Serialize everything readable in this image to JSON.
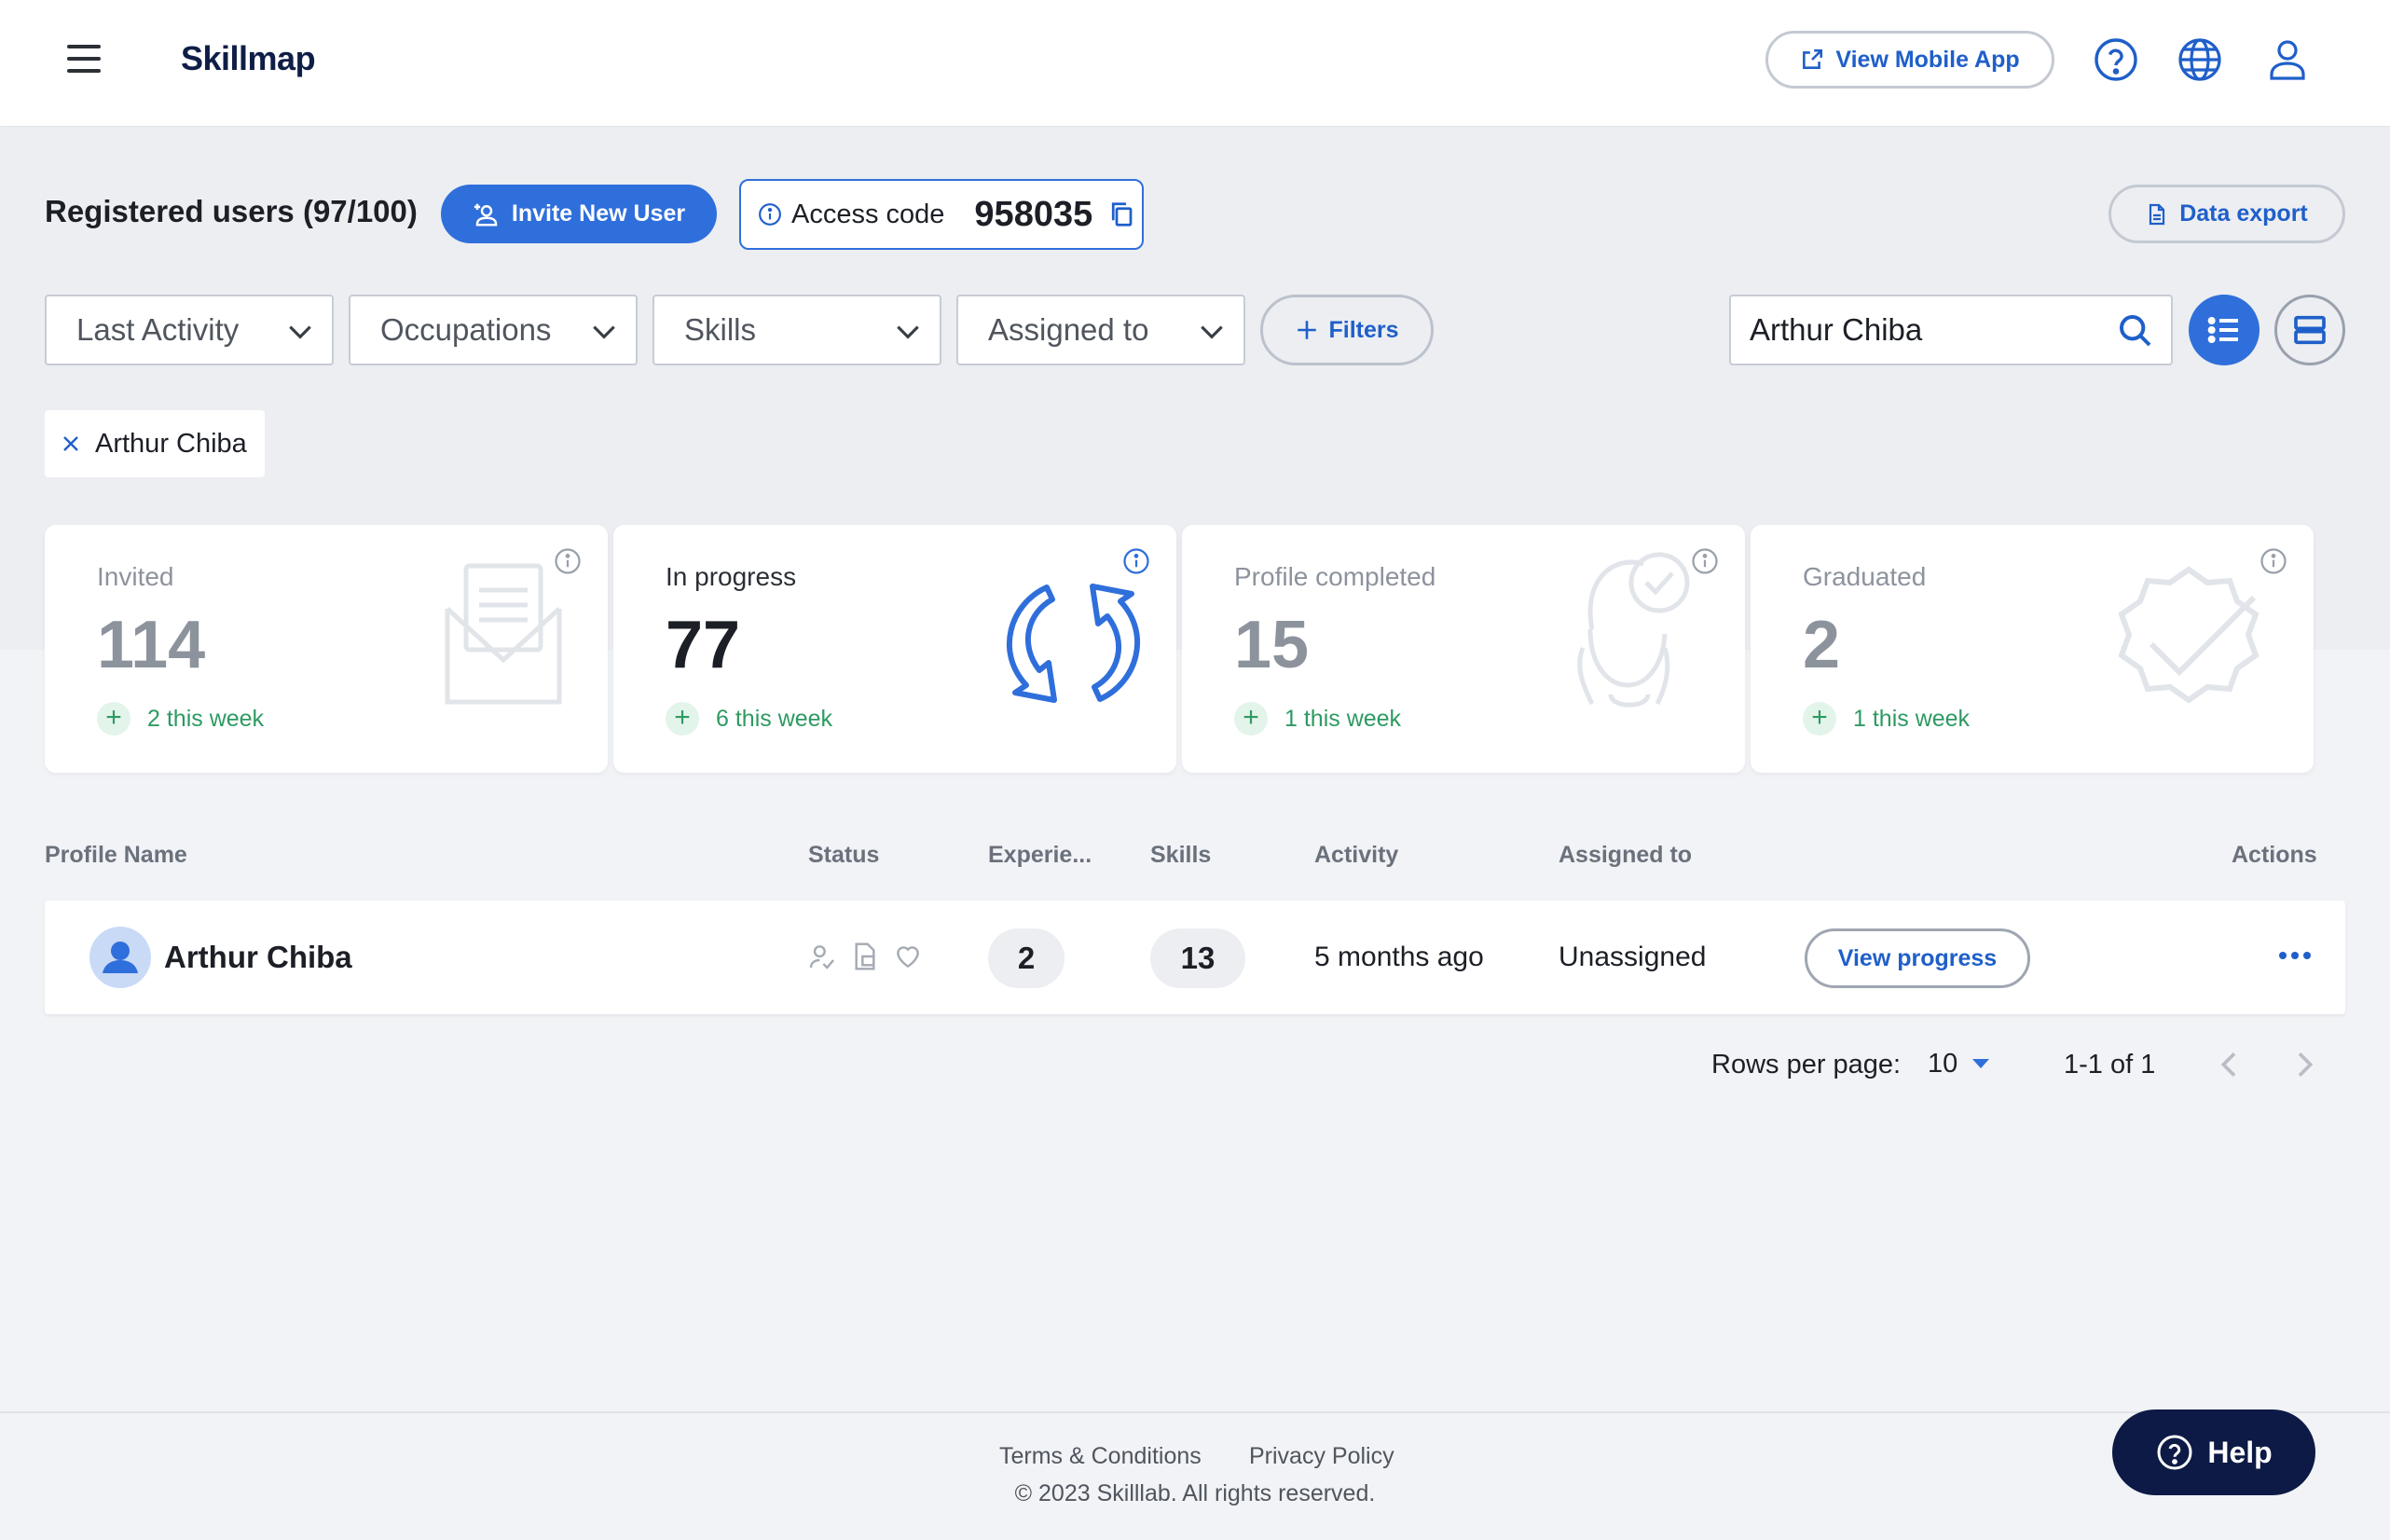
{
  "header": {
    "brand": "Skillmap",
    "mobile_app_label": "View Mobile App",
    "icons": [
      "menu-icon",
      "help-circle-icon",
      "globe-icon",
      "user-icon"
    ]
  },
  "toolbar": {
    "title": "Registered users (97/100)",
    "invite_label": "Invite New User",
    "access_code_label": "Access code",
    "access_code_value": "958035",
    "export_label": "Data export"
  },
  "filters": {
    "dropdowns": [
      "Last Activity",
      "Occupations",
      "Skills",
      "Assigned to"
    ],
    "filters_label": "Filters",
    "search_value": "Arthur Chiba",
    "active_chip": "Arthur Chiba"
  },
  "stats": [
    {
      "label": "Invited",
      "value": "114",
      "week": "2 this week",
      "icon": "envelope-icon"
    },
    {
      "label": "In progress",
      "value": "77",
      "week": "6 this week",
      "icon": "refresh-arrows-icon"
    },
    {
      "label": "Profile completed",
      "value": "15",
      "week": "1 this week",
      "icon": "person-check-icon"
    },
    {
      "label": "Graduated",
      "value": "2",
      "week": "1 this week",
      "icon": "badge-check-icon"
    }
  ],
  "table": {
    "columns": [
      "Profile Name",
      "Status",
      "Experie...",
      "Skills",
      "Activity",
      "Assigned to",
      "Actions"
    ],
    "rows": [
      {
        "name": "Arthur Chiba",
        "experience": "2",
        "skills": "13",
        "activity": "5 months ago",
        "assigned": "Unassigned",
        "action_label": "View progress"
      }
    ]
  },
  "pager": {
    "rows_label": "Rows per page:",
    "rows_value": "10",
    "range": "1-1 of 1"
  },
  "footer": {
    "terms": "Terms & Conditions",
    "privacy": "Privacy Policy",
    "copyright": "© 2023 Skilllab. All rights reserved.",
    "help_label": "Help"
  },
  "colors": {
    "accent": "#2f6fdb",
    "brand_dark": "#0c1a45",
    "success": "#2e9a62"
  }
}
